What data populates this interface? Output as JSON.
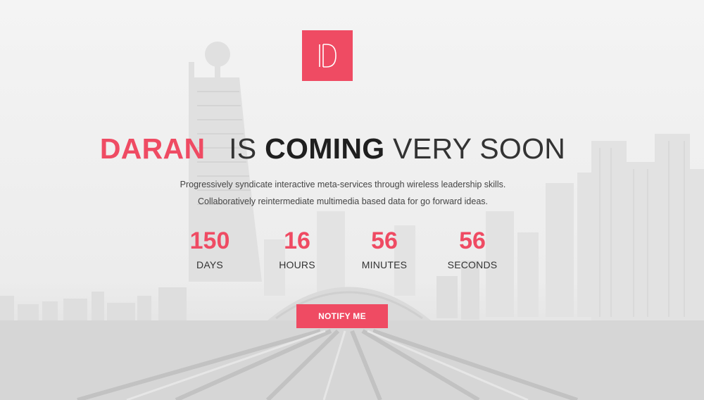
{
  "logo": {
    "letter_icon": "D-monogram-icon"
  },
  "headline": {
    "brand": "DARAN",
    "word_is": "IS",
    "word_coming": "COMING",
    "rest": "VERY SOON"
  },
  "tagline": {
    "line1": "Progressively syndicate interactive meta-services through wireless leadership skills.",
    "line2": "Collaboratively reintermediate multimedia based data for go forward ideas."
  },
  "countdown": {
    "days": {
      "value": "150",
      "label": "DAYS"
    },
    "hours": {
      "value": "16",
      "label": "HOURS"
    },
    "minutes": {
      "value": "56",
      "label": "MINUTES"
    },
    "seconds": {
      "value": "56",
      "label": "SECONDS"
    }
  },
  "cta": {
    "label": "NOTIFY ME"
  },
  "colors": {
    "accent": "#ef4b63",
    "text_dark": "#1f1f1f",
    "background": "#efefef"
  }
}
